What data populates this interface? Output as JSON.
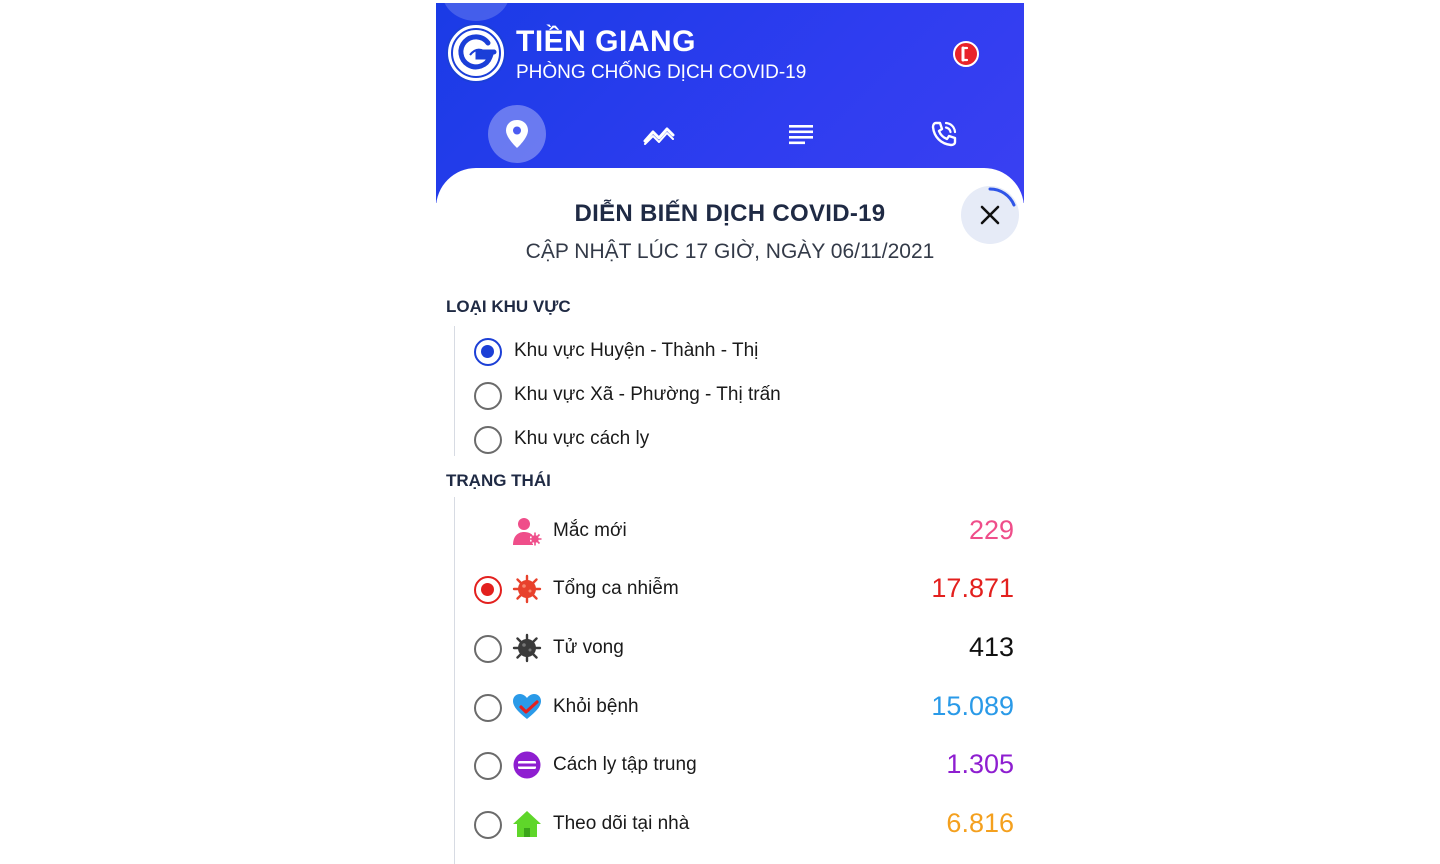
{
  "app": {
    "title": "TIỀN GIANG",
    "subtitle": "PHÒNG CHỐNG DỊCH COVID-19",
    "brand_color": "#2a3cf0"
  },
  "nav": {
    "items": [
      {
        "icon": "location-pin-icon",
        "active": true
      },
      {
        "icon": "trend-chart-icon",
        "active": false
      },
      {
        "icon": "list-icon",
        "active": false
      },
      {
        "icon": "phone-call-icon",
        "active": false
      }
    ]
  },
  "panel": {
    "title": "DIỄN BIẾN DỊCH COVID-19",
    "subtitle": "CẬP NHẬT LÚC 17 GIỜ, NGÀY 06/11/2021"
  },
  "area_type": {
    "label": "LOẠI KHU VỰC",
    "options": [
      {
        "label": "Khu vực Huyện - Thành - Thị",
        "selected": true
      },
      {
        "label": "Khu vực Xã - Phường - Thị trấn",
        "selected": false
      },
      {
        "label": "Khu vực cách ly",
        "selected": false
      }
    ]
  },
  "status": {
    "label": "TRẠNG THÁI",
    "items": [
      {
        "label": "Mắc mới",
        "value": "229",
        "color": "#ef4e8a",
        "icon": "new-case-person-icon"
      },
      {
        "label": "Tổng ca nhiễm",
        "value": "17.871",
        "color": "#e3201e",
        "icon": "virus-red-icon",
        "selected": true
      },
      {
        "label": "Tử vong",
        "value": "413",
        "color": "#111111",
        "icon": "virus-black-icon"
      },
      {
        "label": "Khỏi bệnh",
        "value": "15.089",
        "color": "#2a9ae8",
        "icon": "heart-check-icon"
      },
      {
        "label": "Cách ly tập trung",
        "value": "1.305",
        "color": "#8e1ed0",
        "icon": "quarantine-icon"
      },
      {
        "label": "Theo dõi tại nhà",
        "value": "6.816",
        "color": "#f4a01e",
        "icon": "home-icon"
      }
    ]
  }
}
